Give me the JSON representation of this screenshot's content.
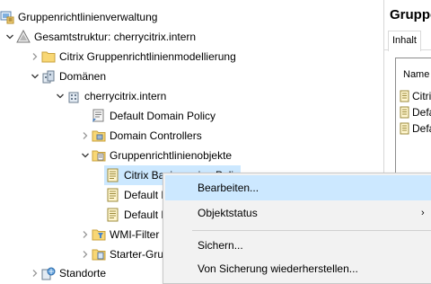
{
  "tree": {
    "root": "Gruppenrichtlinienverwaltung",
    "forest": "Gesamtstruktur: cherrycitrix.intern",
    "modeling": "Citrix Gruppenrichtlinienmodellierung",
    "domains": "Domänen",
    "domain": "cherrycitrix.intern",
    "default_domain_policy": "Default Domain Policy",
    "domain_controllers": "Domain Controllers",
    "gpo_container": "Gruppenrichtlinienobjekte",
    "gpo_selected": "Citrix Basisversion Policy",
    "gpo_default1": "Default Domain Policy",
    "gpo_default2": "Default Domain Controllers Policy",
    "wmi": "WMI-Filter",
    "starter": "Starter-Gruppenrichtlinienobjekte",
    "sites": "Standorte"
  },
  "right_pane": {
    "title": "Gruppenrichtlinienobjekte",
    "tab": "Inhalt",
    "column_header": "Name",
    "rows": [
      "Citrix Basisversion Policy",
      "Default Domain Controllers Policy",
      "Default Domain Policy"
    ]
  },
  "context_menu": {
    "edit": "Bearbeiten...",
    "status": "Objektstatus",
    "status_arrow": "›",
    "backup": "Sichern...",
    "restore": "Von Sicherung wiederherstellen..."
  },
  "colors": {
    "selection": "#cce8ff",
    "menu_bg": "#f2f2f2"
  }
}
